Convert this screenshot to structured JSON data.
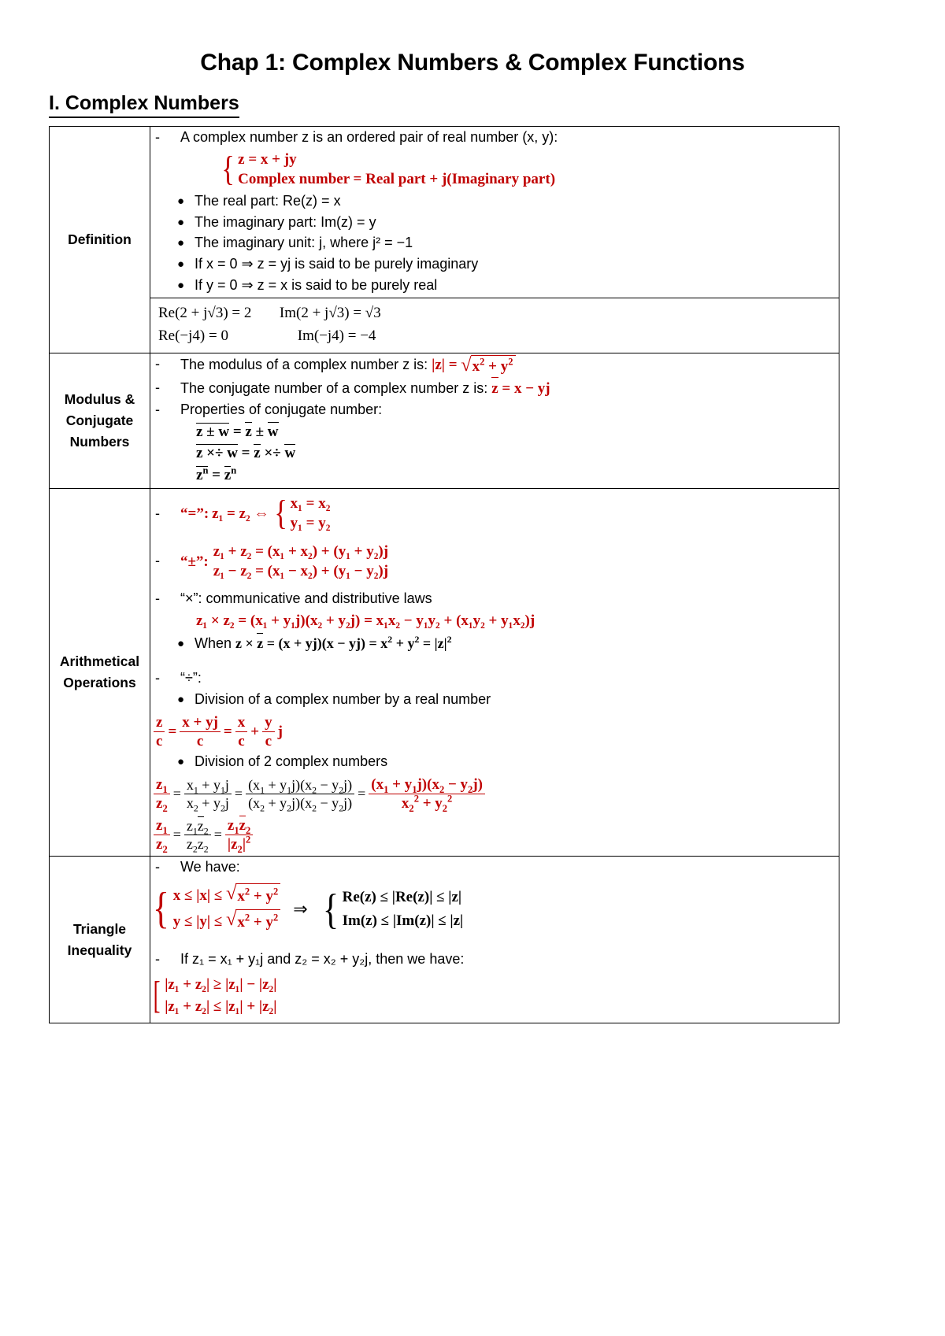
{
  "document": {
    "title": "Chap 1: Complex Numbers & Complex Functions",
    "section_heading": "I. Complex Numbers",
    "accent_color": "#C00000",
    "text_color": "#000000"
  },
  "rows": {
    "definition": {
      "label": "Definition",
      "intro": "A complex number z is an ordered pair of real number (x, y):",
      "brace": {
        "line1": "z = x + jy",
        "line2": "Complex number = Real part + j(Imaginary part)"
      },
      "bullets": [
        "The real part: Re(z) = x",
        "The imaginary part: Im(z) = y",
        "The imaginary unit: j, where j² = −1",
        "If x = 0 ⇒ z = yj is said to be purely imaginary",
        "If y = 0 ⇒ z = x  is said to be purely real"
      ],
      "examples": [
        {
          "left": "Re(2 + j√3) = 2",
          "right": "Im(2 + j√3) = √3"
        },
        {
          "left": "Re(−j4) = 0",
          "right": "Im(−j4) = −4"
        }
      ]
    },
    "modulus": {
      "label": "Modulus & Conjugate Numbers",
      "label_lines": [
        "Modulus &",
        "Conjugate",
        "Numbers"
      ],
      "items": [
        {
          "text": "The modulus of a complex number z is:",
          "formula": "|z| = √(x² + y²)"
        },
        {
          "text": "The conjugate number of a complex number z is:",
          "formula": "z̄ = x − yj"
        },
        {
          "text": "Properties of conjugate number:",
          "formula": ""
        }
      ],
      "properties": [
        "z ± w̅ = z̄ ± w̅",
        "z ×÷ w̅ = z̄ ×÷ w̅",
        "zⁿ̅ = z̄ⁿ"
      ]
    },
    "arithmetic": {
      "label": "Arithmetical Operations",
      "label_lines": [
        "Arithmetical",
        "Operations"
      ],
      "equality": {
        "op": "“=”:",
        "lhs": "z₁ = z₂ ⇔",
        "brace_line1": "x₁ = x₂",
        "brace_line2": "y₁ = y₂"
      },
      "addsub": {
        "op": "“±”:",
        "line1": "z₁ + z₂ = (x₁ + x₂) + (y₁ + y₂)j",
        "line2": "z₁ − z₂ = (x₁ − x₂) + (y₁ − y₂)j"
      },
      "multiply": {
        "op": "“×”: communicative and distributive laws",
        "formula": "z₁ × z₂ = (x₁ + y₁j)(x₂ + y₂j) = x₁x₂ − y₁y₂ + (x₁y₂ + y₁x₂)j",
        "bullet": "When z × z̄ = (x + yj)(x − yj) = x² + y² = |z|²"
      },
      "divide": {
        "op": "“÷”:",
        "bullet1": "Division of a complex number by a real number",
        "formula1": "z/c = (x + yj)/c = x/c + (y/c)j",
        "bullet2": "Division of 2 complex numbers",
        "formula2": "z₁/z₂ = (x₁ + y₁j)/(x₂ + y₂j) = (x₁ + y₁j)(x₂ − y₂j)/((x₂ + y₂j)(x₂ − y₂j)) = (x₁ + y₁j)(x₂ − y₂j)/(x₂² + y₂²)",
        "formula3": "z₁/z₂ = z₁z̄₂/(z₂z̄₂) = z₁z̄₂/|z₂|²"
      }
    },
    "triangle": {
      "label": "Triangle Inequality",
      "label_lines": [
        "Triangle",
        "Inequality"
      ],
      "we_have": "We have:",
      "left_brace": {
        "line1": "x ≤ |x| ≤ √(x² + y²)",
        "line2": "y ≤ |y| ≤ √(x² + y²)"
      },
      "implies": "⇒",
      "right_brace": {
        "line1": "Re(z) ≤ |Re(z)| ≤ |z|",
        "line2": "Im(z) ≤ |Im(z)| ≤ |z|"
      },
      "if_line": "If z₁ = x₁ + y₁j and z₂ = x₂ + y₂j, then we have:",
      "bracket": {
        "line1": "|z₁ + z₂| ≥ |z₁| − |z₂|",
        "line2": "|z₁ + z₂| ≤ |z₁| + |z₂|"
      }
    }
  },
  "markers": {
    "dash": "-",
    "bullet": "●"
  }
}
